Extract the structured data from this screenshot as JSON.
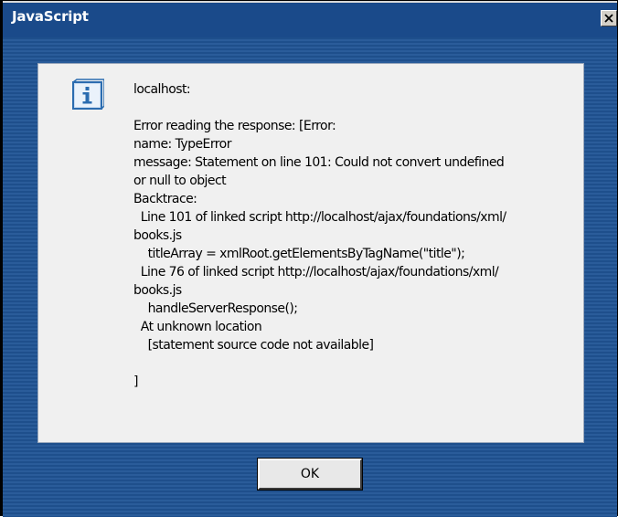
{
  "window": {
    "title": "JavaScript",
    "close_icon": "close-icon"
  },
  "dialog": {
    "icon": "info-icon",
    "message_lines": [
      "localhost:",
      "",
      "Error reading the response: [Error:",
      "name: TypeError",
      "message: Statement on line 101: Could not convert undefined",
      "or null to object",
      "Backtrace:",
      "  Line 101 of linked script http://localhost/ajax/foundations/xml/",
      "books.js",
      "    titleArray = xmlRoot.getElementsByTagName(\"title\");",
      "  Line 76 of linked script http://localhost/ajax/foundations/xml/",
      "books.js",
      "    handleServerResponse();",
      "  At unknown location",
      "    [statement source code not available]",
      "",
      "]"
    ],
    "ok_label": "OK"
  },
  "colors": {
    "titlebar": "#1a4a8a",
    "body_background": "#1e4f8c",
    "panel": "#f0f0f0",
    "icon_blue": "#2b6cb0"
  }
}
